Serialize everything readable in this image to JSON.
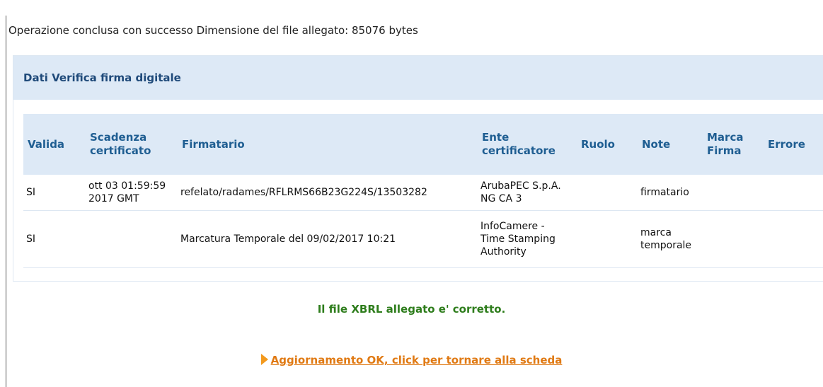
{
  "status": {
    "message": "Operazione conclusa con successo Dimensione del file allegato: 85076 bytes"
  },
  "panel": {
    "title": "Dati Verifica firma digitale"
  },
  "table": {
    "headers": {
      "valida": "Valida",
      "scadenza_line1": "Scadenza",
      "scadenza_line2": "certificato",
      "firmatario": "Firmatario",
      "ente_line1": "Ente",
      "ente_line2": "certificatore",
      "ruolo": "Ruolo",
      "note": "Note",
      "marca_line1": "Marca",
      "marca_line2": "Firma",
      "errore": "Errore"
    },
    "rows": [
      {
        "valida": "SI",
        "scadenza_line1": "ott 03 01:59:59",
        "scadenza_line2": "2017 GMT",
        "firmatario": "refelato/radames/RFLRMS66B23G224S/13503282",
        "ente_line1": "ArubaPEC S.p.A.",
        "ente_line2": "NG CA 3",
        "ente_line3": "",
        "ruolo": "",
        "note_line1": "firmatario",
        "note_line2": "",
        "marca": "",
        "errore": ""
      },
      {
        "valida": "SI",
        "scadenza_line1": "",
        "scadenza_line2": "",
        "firmatario": "Marcatura Temporale del 09/02/2017 10:21",
        "ente_line1": "InfoCamere -",
        "ente_line2": "Time Stamping",
        "ente_line3": "Authority",
        "ruolo": "",
        "note_line1": "marca",
        "note_line2": "temporale",
        "marca": "",
        "errore": ""
      }
    ]
  },
  "result": {
    "message": "Il file XBRL allegato e' corretto."
  },
  "link": {
    "label": "Aggiornamento OK, click per tornare alla scheda",
    "icon": "arrow-right-icon"
  },
  "colors": {
    "header_bg": "#dde9f6",
    "header_text": "#1f5e92",
    "note_red": "#e2231a",
    "ok_green": "#2e7d1c",
    "link_orange": "#e07a14"
  }
}
